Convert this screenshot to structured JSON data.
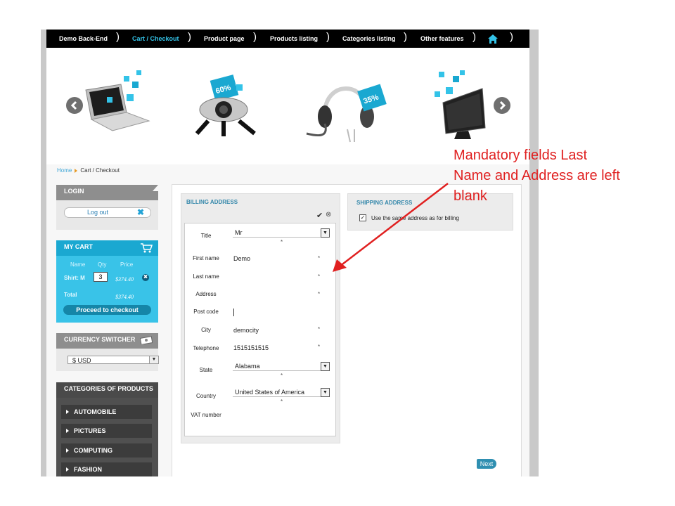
{
  "nav": {
    "items": [
      "Demo Back-End",
      "Cart / Checkout",
      "Product page",
      "Products listing",
      "Categories listing",
      "Other features"
    ],
    "active_index": 1,
    "separator": ")",
    "home_icon": "home-icon"
  },
  "banner": {
    "left_arrow_icon": "chevron-left-icon",
    "right_arrow_icon": "chevron-right-icon",
    "product_badges": [
      "60%",
      "35%"
    ]
  },
  "breadcrumb": {
    "home": "Home",
    "current": "Cart / Checkout"
  },
  "login": {
    "title": "LOGIN",
    "logout_label": "Log out",
    "close_symbol": "✖"
  },
  "cart": {
    "title": "MY CART",
    "cart_icon": "shopping-cart-icon",
    "columns": [
      "Name",
      "Qty",
      "Price"
    ],
    "item": {
      "name": "Shirt: M",
      "qty": "3",
      "price": "$374.40"
    },
    "remove_symbol": "✖",
    "total_label": "Total",
    "total_value": "$374.40",
    "checkout_label": "Proceed to checkout"
  },
  "currency": {
    "title": "CURRENCY SWITCHER",
    "selected": "$ USD"
  },
  "categories": {
    "title": "CATEGORIES OF PRODUCTS",
    "items": [
      "AUTOMOBILE",
      "PICTURES",
      "COMPUTING",
      "FASHION"
    ]
  },
  "billing": {
    "title": "BILLING ADDRESS",
    "fields": {
      "title": {
        "label": "Title",
        "value": "Mr"
      },
      "first_name": {
        "label": "First name",
        "value": "Demo"
      },
      "last_name": {
        "label": "Last name",
        "value": ""
      },
      "address": {
        "label": "Address",
        "value": ""
      },
      "post_code": {
        "label": "Post code",
        "value": ""
      },
      "city": {
        "label": "City",
        "value": "democity"
      },
      "telephone": {
        "label": "Telephone",
        "value": "1515151515"
      },
      "state": {
        "label": "State",
        "value": "Alabama"
      },
      "country": {
        "label": "Country",
        "value": "United States of America"
      },
      "vat": {
        "label": "VAT number",
        "value": ""
      }
    },
    "required_mark": "*"
  },
  "shipping": {
    "title": "SHIPPING ADDRESS",
    "same_as_billing_label": "Use the same address as for billing",
    "same_as_billing_checked": true
  },
  "next_label": "Next",
  "annotation": {
    "text": "Mandatory fields Last\nName and Address are left\nblank",
    "color": "#e02020"
  }
}
